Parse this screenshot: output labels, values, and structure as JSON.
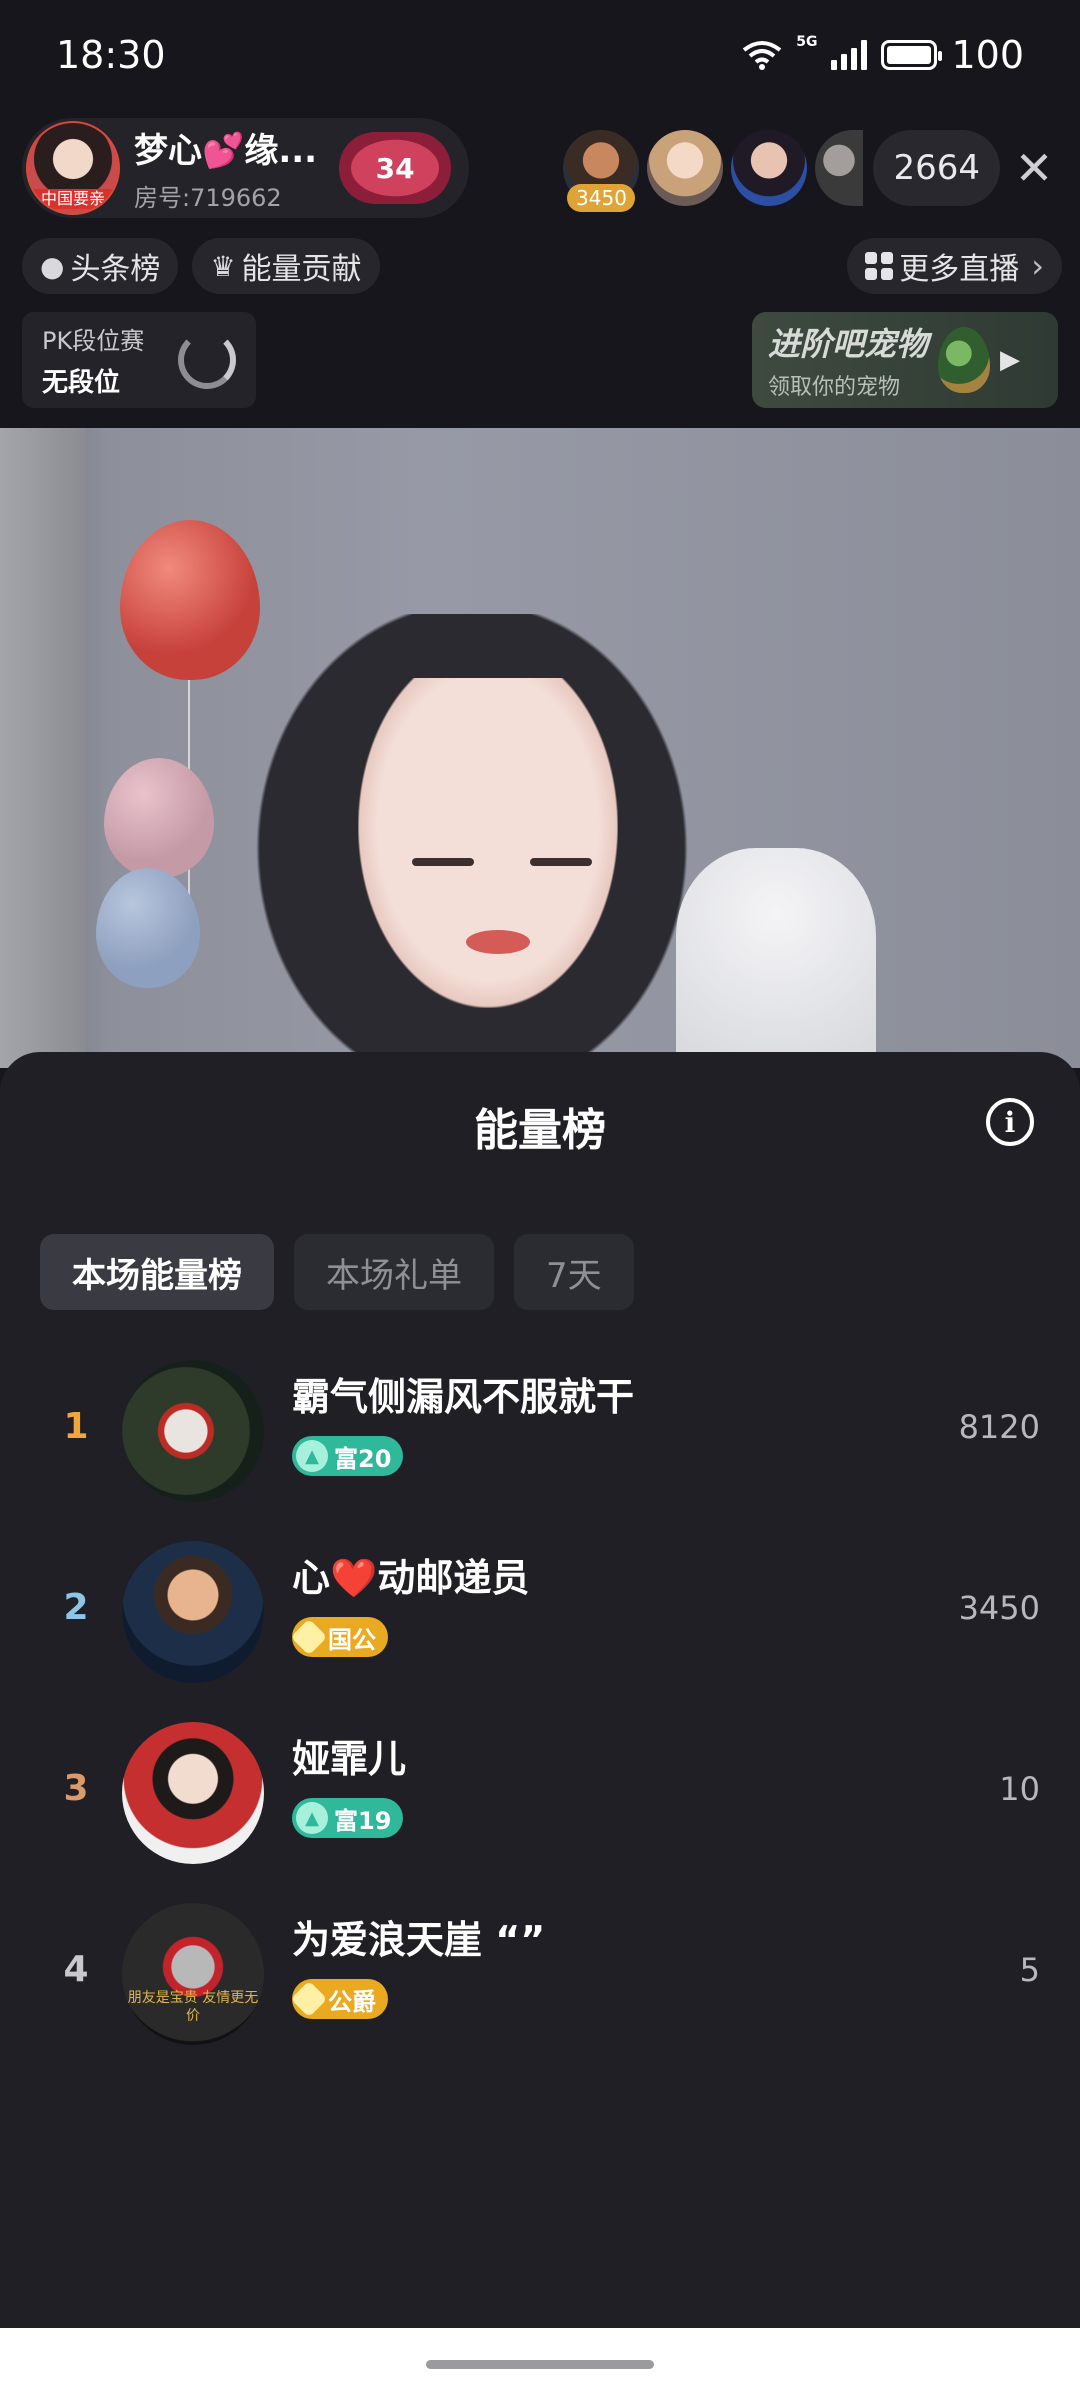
{
  "status_bar": {
    "time": "18:30",
    "network": "5G",
    "battery": "100",
    "icons": [
      "wifi-icon",
      "signal-icon",
      "battery-icon"
    ]
  },
  "host": {
    "name": "梦心💕缘...",
    "room": "房号:719662",
    "avatar_tag": "中国要亲",
    "heart_count": "34"
  },
  "viewers": {
    "first_badge": "3450",
    "count": "2664"
  },
  "sub_row": {
    "headline": "头条榜",
    "energy_contribution": "能量贡献",
    "more_live": "更多直播"
  },
  "pk": {
    "title": "PK段位赛",
    "rank": "无段位"
  },
  "pet": {
    "title": "进阶吧宠物",
    "subtitle": "领取你的宠物"
  },
  "sheet": {
    "title": "能量榜",
    "tabs": [
      {
        "label": "本场能量榜",
        "active": true
      },
      {
        "label": "本场礼单",
        "active": false
      },
      {
        "label": "7天",
        "active": false
      }
    ],
    "ranks": [
      {
        "num": "1",
        "num_color": "#f0a63c",
        "name": "霸气侧漏风不服就干",
        "badge_type": "rich",
        "badge_label": "富20",
        "score": "8120"
      },
      {
        "num": "2",
        "num_color": "#8ec5e6",
        "name_pre": "心",
        "name_heart": "❤️",
        "name_post": "动邮递员",
        "badge_type": "noble",
        "badge_label": "国公",
        "score": "3450"
      },
      {
        "num": "3",
        "num_color": "#d99a6c",
        "name": "娅霏儿",
        "badge_type": "rich",
        "badge_label": "富19",
        "score": "10"
      },
      {
        "num": "4",
        "num_color": "#c9c9cd",
        "name": "为爱浪天崖 “”",
        "badge_type": "noble",
        "badge_label": "公爵",
        "score": "5",
        "avatar_text": "朋友是宝贵 友情更无价"
      }
    ]
  },
  "colors": {
    "background": "#17161d",
    "sheet": "#1f1f25",
    "rich_badge": "#2fb89a",
    "noble_badge": "#e9a921"
  }
}
